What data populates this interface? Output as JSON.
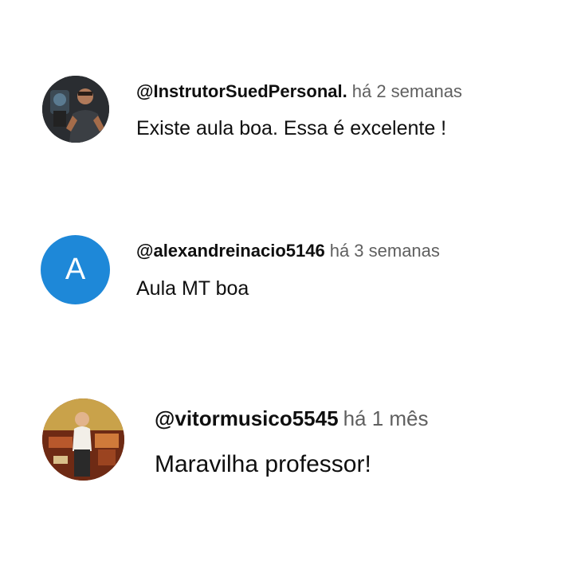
{
  "comments": [
    {
      "author": "@InstrutorSuedPersonal.",
      "time": "há 2 semanas",
      "text": "Existe aula boa. Essa é excelente !",
      "avatar": {
        "type": "photo",
        "icon": "person-photo-gym"
      }
    },
    {
      "author": "@alexandreinacio5146",
      "time": "há 3 semanas",
      "text": "Aula MT boa",
      "avatar": {
        "type": "letter",
        "letter": "A",
        "color": "#1e88d8"
      }
    },
    {
      "author": "@vitormusico5545",
      "time": "há 1 mês",
      "text": "Maravilha professor!",
      "avatar": {
        "type": "photo",
        "icon": "person-photo-stage"
      }
    }
  ],
  "colors": {
    "author": "#0f0f0f",
    "time": "#606060",
    "text": "#0f0f0f",
    "background": "#ffffff"
  }
}
